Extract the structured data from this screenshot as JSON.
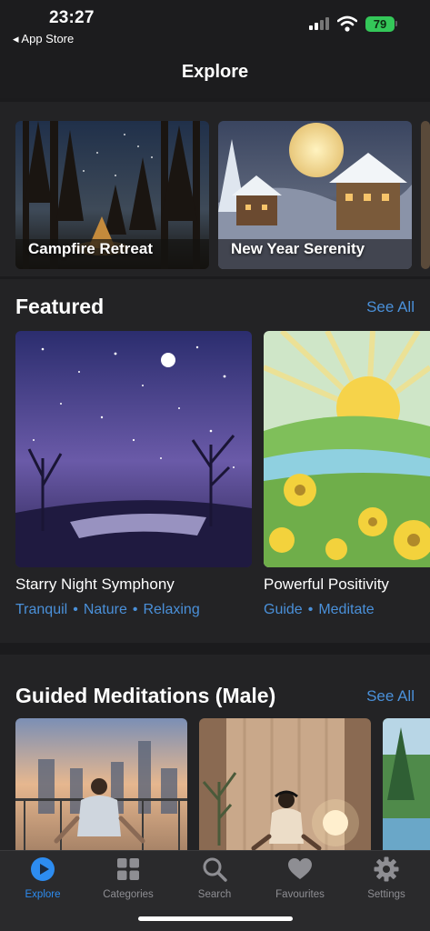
{
  "status_bar": {
    "time": "23:27",
    "back_label": "◂ App Store",
    "battery": "79"
  },
  "header": {
    "title": "Explore"
  },
  "carousel": {
    "items": [
      {
        "label": "Campfire Retreat"
      },
      {
        "label": "New Year Serenity"
      }
    ]
  },
  "featured": {
    "title": "Featured",
    "see_all": "See All",
    "items": [
      {
        "title": "Starry Night Symphony",
        "tags": [
          "Tranquil",
          "Nature",
          "Relaxing"
        ]
      },
      {
        "title": "Powerful Positivity",
        "tags": [
          "Guide",
          "Meditate"
        ]
      }
    ]
  },
  "guided": {
    "title": "Guided Meditations (Male)",
    "see_all": "See All"
  },
  "tabbar": {
    "items": [
      {
        "label": "Explore",
        "icon": "play-circle-icon",
        "active": true
      },
      {
        "label": "Categories",
        "icon": "grid-icon"
      },
      {
        "label": "Search",
        "icon": "search-icon"
      },
      {
        "label": "Favourites",
        "icon": "heart-icon"
      },
      {
        "label": "Settings",
        "icon": "gear-icon"
      }
    ]
  },
  "colors": {
    "accent": "#2d8cf0",
    "link": "#4a90d9",
    "battery": "#34c759"
  }
}
